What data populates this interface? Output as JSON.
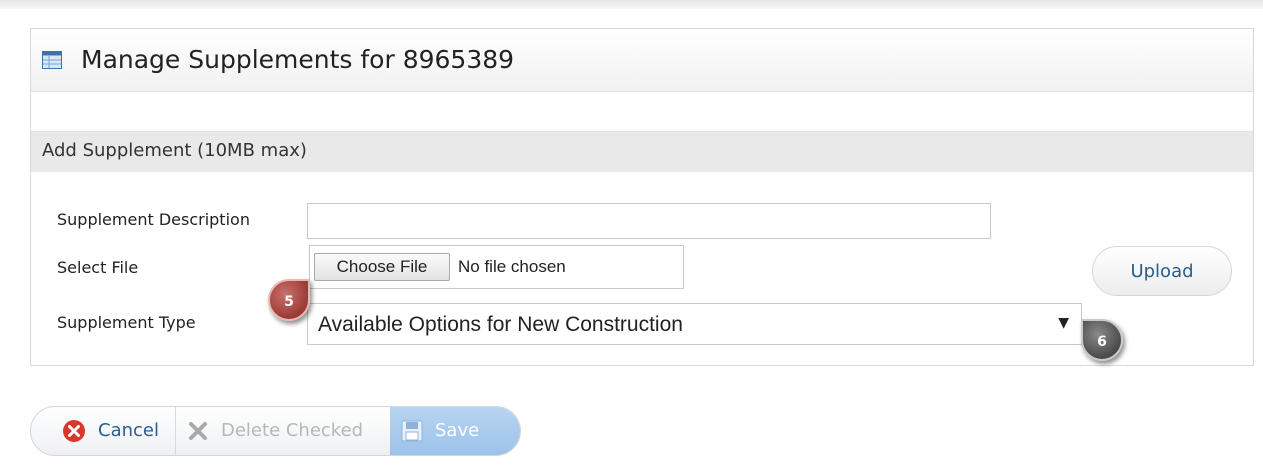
{
  "panel": {
    "title": "Manage Supplements for 8965389",
    "icon": "table-icon"
  },
  "section": {
    "title": "Add Supplement (10MB max)"
  },
  "form": {
    "description_label": "Supplement Description",
    "description_value": "",
    "file_label": "Select File",
    "choose_file_label": "Choose File",
    "no_file_text": "No file chosen",
    "type_label": "Supplement Type",
    "type_selected": "Available Options for New Construction",
    "upload_label": "Upload"
  },
  "callouts": {
    "step5": "5",
    "step6": "6"
  },
  "toolbar": {
    "cancel_label": "Cancel",
    "delete_label": "Delete Checked",
    "save_label": "Save",
    "cancel_icon": "cancel-x-circle-icon",
    "delete_icon": "delete-x-icon",
    "save_icon": "floppy-disk-icon"
  },
  "colors": {
    "link_blue": "#2a5d8f",
    "callout_red": "#9c3a35",
    "callout_gray": "#4a4a4a",
    "save_blue": "#9cc2ea"
  }
}
